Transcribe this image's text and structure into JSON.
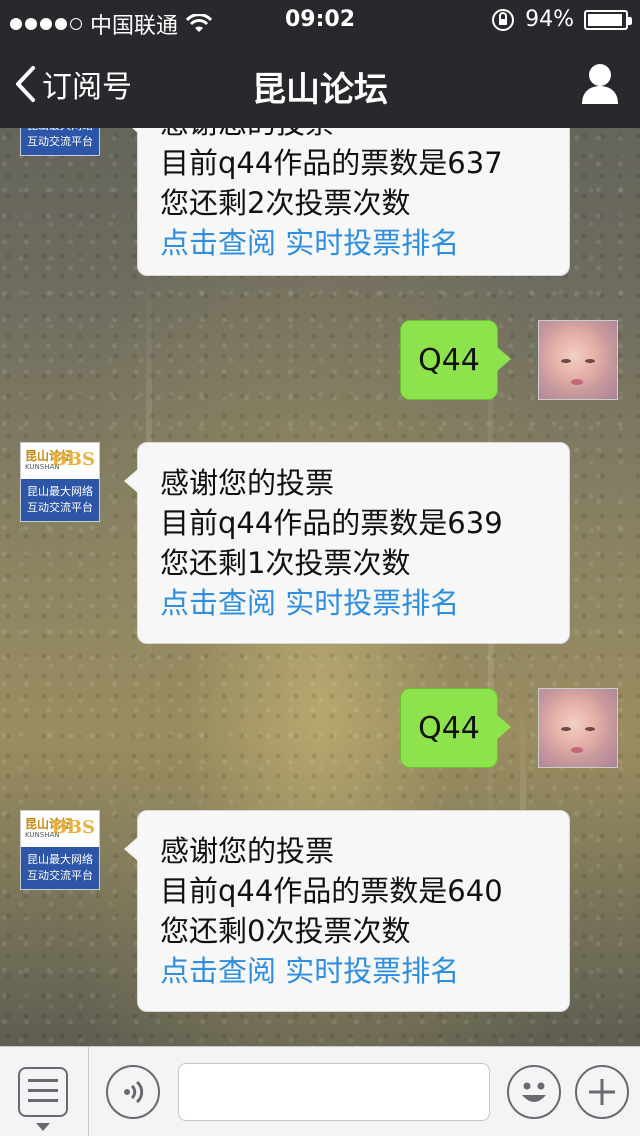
{
  "status_bar": {
    "carrier": "中国联通",
    "time": "09:02",
    "battery": "94%",
    "battery_level": 0.94
  },
  "nav": {
    "back_label": "订阅号",
    "title": "昆山论坛"
  },
  "bbs_avatar": {
    "cn": "昆山论坛",
    "en": "KUNSHAN",
    "bbs": "BBS",
    "slogan_line1": "昆山最大网络",
    "slogan_line2": "互动交流平台"
  },
  "messages": [
    {
      "type": "in",
      "partial_line": "感谢您的投票",
      "line1": "目前q44作品的票数是637",
      "line2": "您还剩2次投票次数",
      "link1": "点击查阅",
      "link2": "实时投票排名"
    },
    {
      "type": "out",
      "text": "Q44"
    },
    {
      "type": "in",
      "line0": "感谢您的投票",
      "line1": "目前q44作品的票数是639",
      "line2": "您还剩1次投票次数",
      "link1": "点击查阅",
      "link2": "实时投票排名"
    },
    {
      "type": "out",
      "text": "Q44"
    },
    {
      "type": "in",
      "line0": "感谢您的投票",
      "line1": "目前q44作品的票数是640",
      "line2": "您还剩0次投票次数",
      "link1": "点击查阅",
      "link2": "实时投票排名"
    }
  ],
  "input": {
    "value": "",
    "placeholder": ""
  },
  "colors": {
    "bar": "#27292c",
    "out_bubble": "#8ee34c",
    "link": "#2f8ee0"
  }
}
